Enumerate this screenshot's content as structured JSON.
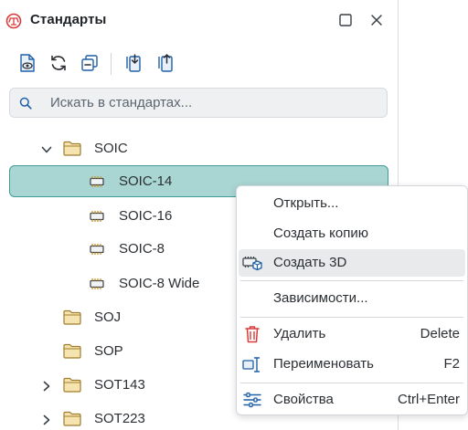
{
  "panel": {
    "title": "Стандарты",
    "icons": {
      "app": "standards-icon",
      "maximize": "maximize-icon",
      "close": "close-icon"
    }
  },
  "toolbar": {
    "tools": [
      "view-document-icon",
      "refresh-icon",
      "collapse-icon",
      "import-icon",
      "export-icon"
    ]
  },
  "search": {
    "placeholder": "Искать в стандартах..."
  },
  "tree": {
    "items": [
      {
        "label": "SOIC",
        "kind": "folder",
        "expanded": true
      },
      {
        "label": "SOIC-14",
        "kind": "component",
        "selected": true
      },
      {
        "label": "SOIC-16",
        "kind": "component"
      },
      {
        "label": "SOIC-8",
        "kind": "component"
      },
      {
        "label": "SOIC-8 Wide",
        "kind": "component"
      },
      {
        "label": "SOJ",
        "kind": "folder"
      },
      {
        "label": "SOP",
        "kind": "folder"
      },
      {
        "label": "SOT143",
        "kind": "folder",
        "expandable": true
      },
      {
        "label": "SOT223",
        "kind": "folder",
        "expandable": true
      }
    ]
  },
  "context_menu": {
    "items": [
      {
        "label": "Открыть...",
        "shortcut": ""
      },
      {
        "label": "Создать копию",
        "shortcut": ""
      },
      {
        "label": "Создать 3D",
        "shortcut": "",
        "icon": "create-3d-icon",
        "hovered": true
      },
      {
        "label": "Зависимости...",
        "shortcut": ""
      },
      {
        "label": "Удалить",
        "shortcut": "Delete",
        "icon": "trash-icon"
      },
      {
        "label": "Переименовать",
        "shortcut": "F2",
        "icon": "rename-icon"
      },
      {
        "label": "Свойства",
        "shortcut": "Ctrl+Enter",
        "icon": "properties-icon"
      }
    ]
  },
  "colors": {
    "accent": "#3f9c96",
    "selection": "#a9d5d2",
    "danger": "#d93b3b",
    "icon_blue": "#1f5fa8",
    "folder": "#e2c06a"
  }
}
